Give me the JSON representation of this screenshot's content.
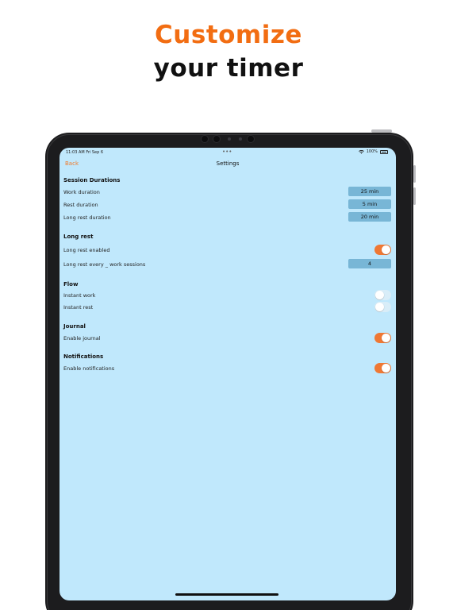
{
  "promo": {
    "line1": "Customize",
    "line2": "your timer",
    "line1_color": "#f26d12"
  },
  "status_bar": {
    "time": "11:03 AM  Fri Sep 6",
    "more": "•••",
    "battery": "100%"
  },
  "nav": {
    "back_label": "Back",
    "title": "Settings"
  },
  "sections": {
    "session_durations": {
      "title": "Session Durations",
      "work": {
        "label": "Work duration",
        "value": "25 min"
      },
      "rest": {
        "label": "Rest duration",
        "value": "5 min"
      },
      "long_rest": {
        "label": "Long rest duration",
        "value": "20 min"
      }
    },
    "long_rest": {
      "title": "Long rest",
      "enabled": {
        "label": "Long rest enabled",
        "on": true
      },
      "every": {
        "label": "Long rest every _ work sessions",
        "value": "4"
      }
    },
    "flow": {
      "title": "Flow",
      "instant_work": {
        "label": "Instant work",
        "on": false
      },
      "instant_rest": {
        "label": "Instant rest",
        "on": false
      }
    },
    "journal": {
      "title": "Journal",
      "enable": {
        "label": "Enable journal",
        "on": true
      }
    },
    "notifications": {
      "title": "Notifications",
      "enable": {
        "label": "Enable notifications",
        "on": true
      }
    }
  },
  "colors": {
    "accent": "#ef7834",
    "screen_bg": "#c0e8fc",
    "value_box": "#78b6d6"
  },
  "icons": [
    "wifi-icon",
    "battery-icon"
  ]
}
